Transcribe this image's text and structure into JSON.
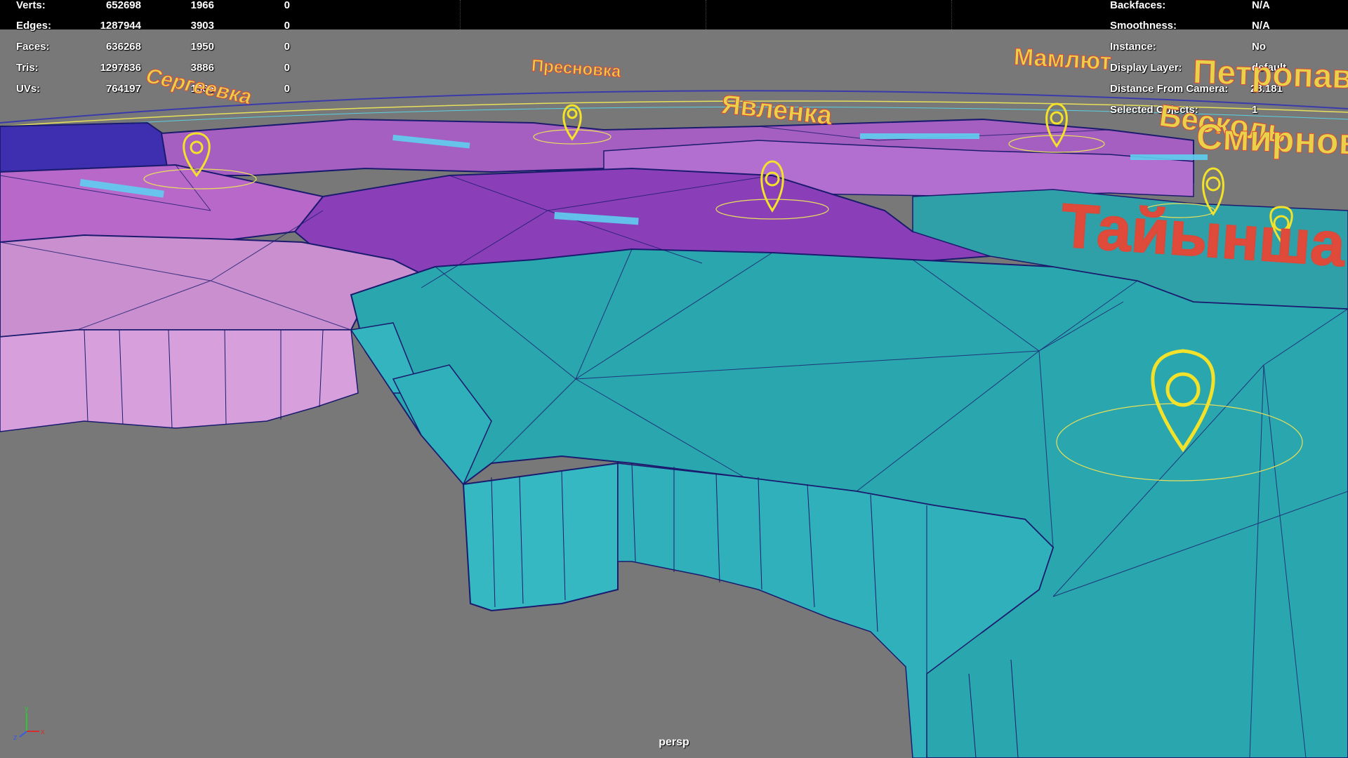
{
  "heads_up": {
    "poly_count": [
      {
        "label": "Verts:",
        "total": "652698",
        "selected": "1966",
        "extra": "0"
      },
      {
        "label": "Edges:",
        "total": "1287944",
        "selected": "3903",
        "extra": "0"
      },
      {
        "label": "Faces:",
        "total": "636268",
        "selected": "1950",
        "extra": "0"
      },
      {
        "label": "Tris:",
        "total": "1297836",
        "selected": "3886",
        "extra": "0"
      },
      {
        "label": "UVs:",
        "total": "764197",
        "selected": "1366",
        "extra": "0"
      }
    ],
    "object_details": [
      {
        "label": "Backfaces:",
        "value": "N/A"
      },
      {
        "label": "Smoothness:",
        "value": "N/A"
      },
      {
        "label": "Instance:",
        "value": "No"
      },
      {
        "label": "Display Layer:",
        "value": "default"
      },
      {
        "label": "Distance From Camera:",
        "value": "28.181"
      },
      {
        "label": "Selected Objects:",
        "value": "1"
      }
    ]
  },
  "map_labels": [
    {
      "text": "Сергеевка"
    },
    {
      "text": "Пресновка"
    },
    {
      "text": "Явленка"
    },
    {
      "text": "Мамлют"
    },
    {
      "text": "Петропавловск"
    },
    {
      "text": "Бесколь"
    },
    {
      "text": "Смирново"
    },
    {
      "text": "Тайынша"
    }
  ],
  "viewport": {
    "camera": "persp",
    "axis_labels": {
      "x": "x",
      "y": "y",
      "z": "z"
    }
  },
  "colors": {
    "background": "#787878",
    "teal_region": "#2aa6ae",
    "magenta_region": "#a45fc0",
    "purple_region": "#8a3fb8",
    "pink_region": "#c98fcf",
    "blue_region": "#3d2fb0",
    "wire": "#1a1a6e",
    "pin": "#f2e22a",
    "label_fill": "#e8d24a",
    "label_stroke": "#d94a3a"
  }
}
